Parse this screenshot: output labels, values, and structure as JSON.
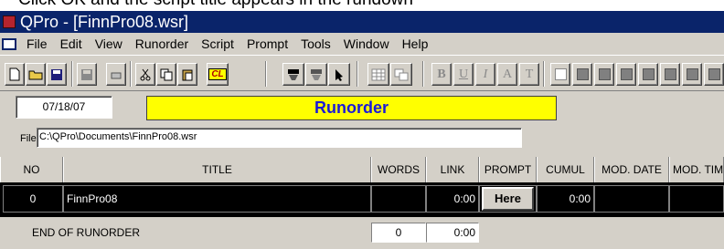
{
  "caption": "Click OK and the script title appears in the rundown",
  "window": {
    "title": "QPro - [FinnPro08.wsr]"
  },
  "menu": [
    "File",
    "Edit",
    "View",
    "Runorder",
    "Script",
    "Prompt",
    "Tools",
    "Window",
    "Help"
  ],
  "toolbar": {
    "bold": "B",
    "underline": "U",
    "italic": "I",
    "cl": "CL",
    "font_a": "A",
    "font_b": "T"
  },
  "panel": {
    "date": "07/18/07",
    "title": "Runorder",
    "file_label": "File:",
    "file_path": "C:\\QPro\\Documents\\FinnPro08.wsr"
  },
  "table": {
    "headers": [
      "NO",
      "TITLE",
      "WORDS",
      "LINK",
      "PROMPT",
      "CUMUL",
      "MOD. DATE",
      "MOD. TIM"
    ],
    "rows": [
      {
        "no": "0",
        "title": "FinnPro08",
        "words": "",
        "link": "0:00",
        "prompt": "Here",
        "cumul": "0:00",
        "mod_date": "",
        "mod_time": ""
      }
    ]
  },
  "footer": {
    "label": "END OF RUNORDER",
    "words": "0",
    "link": "0:00"
  },
  "colors": {
    "titlebar": "#0a246a",
    "title_bg": "#ffff00",
    "title_text": "#1a1ad9",
    "panel": "#d4d0c8"
  }
}
